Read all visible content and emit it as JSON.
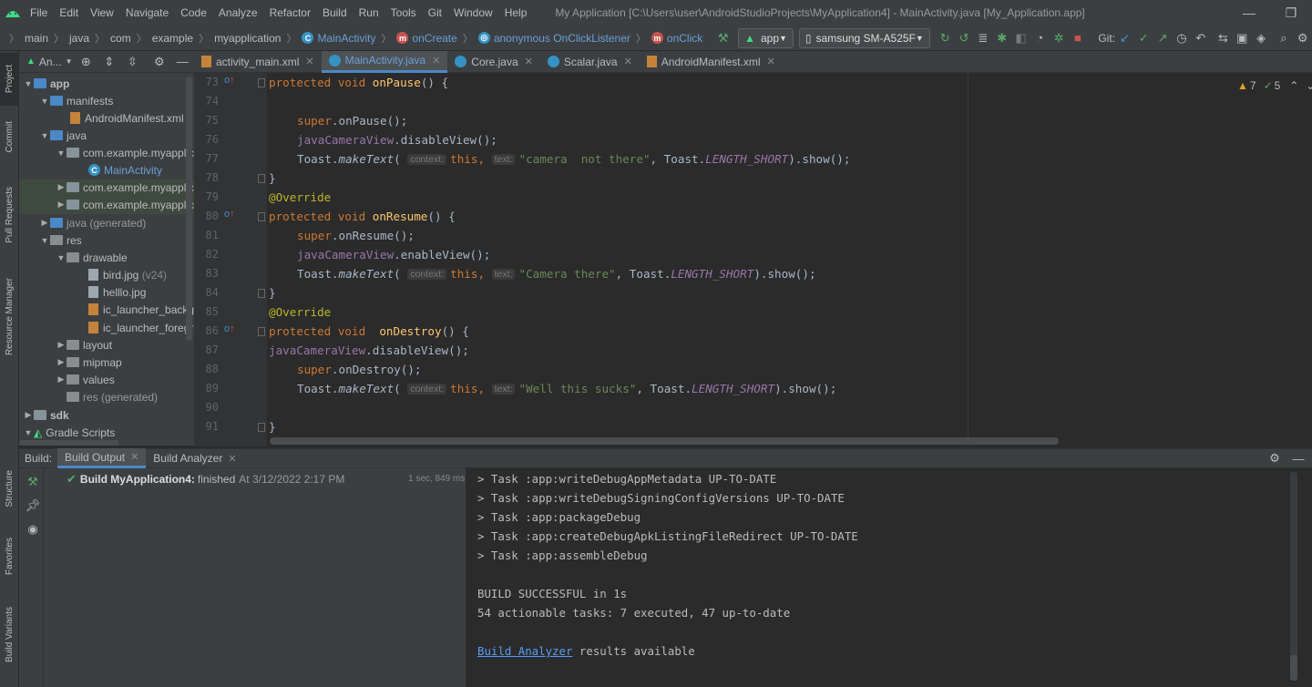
{
  "menubar": {
    "items": [
      "File",
      "Edit",
      "View",
      "Navigate",
      "Code",
      "Analyze",
      "Refactor",
      "Build",
      "Run",
      "Tools",
      "Git",
      "Window",
      "Help"
    ],
    "title": "My Application [C:\\Users\\user\\AndroidStudioProjects\\MyApplication4] - MainActivity.java [My_Application.app]"
  },
  "breadcrumb": {
    "items": [
      "main",
      "java",
      "com",
      "example",
      "myapplication"
    ],
    "main_activity": "MainActivity",
    "on_create": "onCreate",
    "listener": "anonymous OnClickListener",
    "on_click": "onClick"
  },
  "toolbar": {
    "run_config": "app",
    "device": "samsung SM-A525F",
    "git_label": "Git:"
  },
  "left_strip": {
    "project": "Project",
    "commit": "Commit",
    "pull_requests": "Pull Requests",
    "resource_manager": "Resource Manager",
    "structure": "Structure",
    "favorites": "Favorites",
    "build_variants": "Build Variants"
  },
  "project_panel": {
    "view_label": "An..."
  },
  "tree": [
    {
      "label": "app",
      "bold": true
    },
    {
      "label": "manifests"
    },
    {
      "label": "AndroidManifest.xml"
    },
    {
      "label": "java"
    },
    {
      "label": "com.example.myapplication"
    },
    {
      "label": "MainActivity"
    },
    {
      "label": "com.example.myapplication"
    },
    {
      "label": "com.example.myapplication"
    },
    {
      "label": "java (generated)"
    },
    {
      "label": "res"
    },
    {
      "label": "drawable"
    },
    {
      "label": "bird.jpg",
      "suffix": "(v24)"
    },
    {
      "label": "helllo.jpg"
    },
    {
      "label": "ic_launcher_background"
    },
    {
      "label": "ic_launcher_foreground"
    },
    {
      "label": "layout"
    },
    {
      "label": "mipmap"
    },
    {
      "label": "values"
    },
    {
      "label": "res (generated)"
    },
    {
      "label": "sdk",
      "bold": true
    },
    {
      "label": "Gradle Scripts"
    }
  ],
  "editor_tabs": [
    {
      "label": "activity_main.xml"
    },
    {
      "label": "MainActivity.java"
    },
    {
      "label": "Core.java"
    },
    {
      "label": "Scalar.java"
    },
    {
      "label": "AndroidManifest.xml"
    }
  ],
  "inspections": {
    "warnings": "7",
    "weak_warnings": "5"
  },
  "line_numbers": [
    "73",
    "74",
    "75",
    "76",
    "77",
    "78",
    "79",
    "80",
    "81",
    "82",
    "83",
    "84",
    "85",
    "86",
    "87",
    "88",
    "89",
    "90",
    "91"
  ],
  "code": {
    "l73": {
      "kw": "protected void ",
      "fn": "onPause",
      "rest": "() {"
    },
    "l75": {
      "kw": "super",
      "rest": ".onPause();"
    },
    "l76": {
      "fld": "javaCameraView",
      "rest": ".disableView();"
    },
    "l77": {
      "a": "Toast.",
      "m": "makeText",
      "b": "( ",
      "h1": "context:",
      "kwthis": "this,",
      "h2": "text:",
      "str": "\"camera  not there\"",
      "c": ", Toast.",
      "const": "LENGTH_SHORT",
      "d": ").show();"
    },
    "l78": {
      "rest": "}"
    },
    "l79": {
      "ann": "@Override"
    },
    "l80": {
      "kw": "protected void ",
      "fn": "onResume",
      "rest": "() {"
    },
    "l81": {
      "kw": "super",
      "rest": ".onResume();"
    },
    "l82": {
      "fld": "javaCameraView",
      "rest": ".enableView();"
    },
    "l83": {
      "a": "Toast.",
      "m": "makeText",
      "b": "( ",
      "h1": "context:",
      "kwthis": "this,",
      "h2": "text:",
      "str": "\"Camera there\"",
      "c": ", Toast.",
      "const": "LENGTH_SHORT",
      "d": ").show();"
    },
    "l84": {
      "rest": "}"
    },
    "l85": {
      "ann": "@Override"
    },
    "l86": {
      "kw": "protected void ",
      "fn": " onDestroy",
      "rest": "() {"
    },
    "l87": {
      "fld": "javaCameraView",
      "rest": ".disableView();"
    },
    "l88": {
      "kw": "super",
      "rest": ".onDestroy();"
    },
    "l89": {
      "a": "Toast.",
      "m": "makeText",
      "b": "( ",
      "h1": "context:",
      "kwthis": "this,",
      "h2": "text:",
      "str": "\"Well this sucks\"",
      "c": ", Toast.",
      "const": "LENGTH_SHORT",
      "d": ").show();"
    },
    "l91": {
      "rest": "}"
    }
  },
  "build": {
    "label": "Build:",
    "tabs": [
      "Build Output",
      "Build Analyzer"
    ],
    "status_title": "Build MyApplication4:",
    "status_text": "finished",
    "status_time": "At 3/12/2022 2:17 PM",
    "duration": "1 sec, 849 ms",
    "console": [
      "> Task :app:writeDebugAppMetadata UP-TO-DATE",
      "> Task :app:writeDebugSigningConfigVersions UP-TO-DATE",
      "> Task :app:packageDebug",
      "> Task :app:createDebugApkListingFileRedirect UP-TO-DATE",
      "> Task :app:assembleDebug",
      "",
      "BUILD SUCCESSFUL in 1s",
      "54 actionable tasks: 7 executed, 47 up-to-date"
    ],
    "analyzer_link": "Build Analyzer",
    "analyzer_rest": " results available"
  },
  "colors": {
    "accent": "#4a88c7",
    "success": "#59a869",
    "editor_bg": "#2b2b2b",
    "panel_bg": "#3c3f41"
  }
}
